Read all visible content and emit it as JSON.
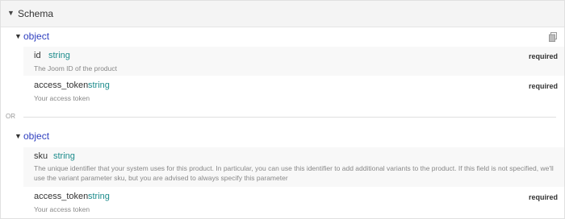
{
  "schema": {
    "title": "Schema"
  },
  "options": [
    {
      "type_label": "object",
      "properties": [
        {
          "name": "id",
          "type": "string",
          "required": "required",
          "description": "The Joom ID of the product"
        },
        {
          "name": "access_token",
          "type": "string",
          "required": "required",
          "description": "Your access token"
        }
      ]
    },
    {
      "type_label": "object",
      "properties": [
        {
          "name": "sku",
          "type": "string",
          "required": "",
          "description": "The unique identifier that your system uses for this product. In particular, you can use this identifier to add additional variants to the product. If this field is not specified, we'll use the variant parameter sku, but you are advised to always specify this parameter"
        },
        {
          "name": "access_token",
          "type": "string",
          "required": "required",
          "description": "Your access token"
        }
      ]
    }
  ],
  "separator": {
    "label": "OR"
  },
  "icons": {
    "collapse": "caret-down-icon",
    "copy": "copy-icon"
  }
}
